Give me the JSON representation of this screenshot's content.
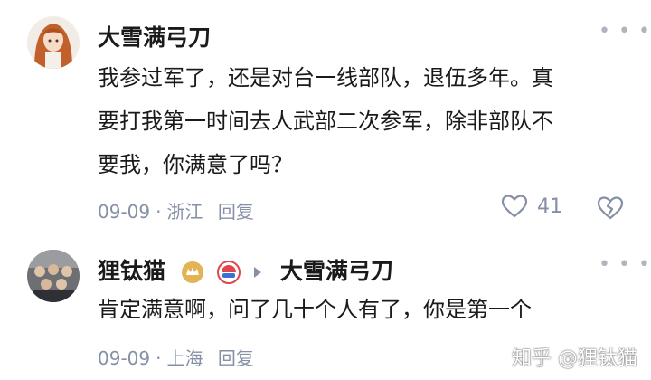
{
  "comments": [
    {
      "username": "大雪满弓刀",
      "text_lines": [
        "我参过军了，还是对台一线部队，退伍多年。真",
        "要打我第一时间去人武部二次参军，除非部队不",
        "要我，你满意了吗？"
      ],
      "date": "09-09",
      "location": "浙江",
      "reply_label": "回复",
      "like_count": "41",
      "more_icon": "more-icon",
      "like_icon": "heart-icon",
      "dislike_icon": "broken-heart-icon"
    },
    {
      "username": "狸钛猫",
      "reply_to": "大雪满弓刀",
      "text_lines": [
        "肯定满意啊，问了几十个人有了，你是第一个"
      ],
      "date": "09-09",
      "location": "上海",
      "reply_label": "回复",
      "more_icon": "more-icon",
      "badge_colors": {
        "gold": "#e2b455",
        "red": "#e0474c",
        "blue": "#3b6fd8"
      }
    }
  ],
  "watermark": "知乎 @狸钛猫",
  "colors": {
    "meta": "#8590a6",
    "text": "#1a1a1a",
    "icon": "#b0b4bc"
  }
}
